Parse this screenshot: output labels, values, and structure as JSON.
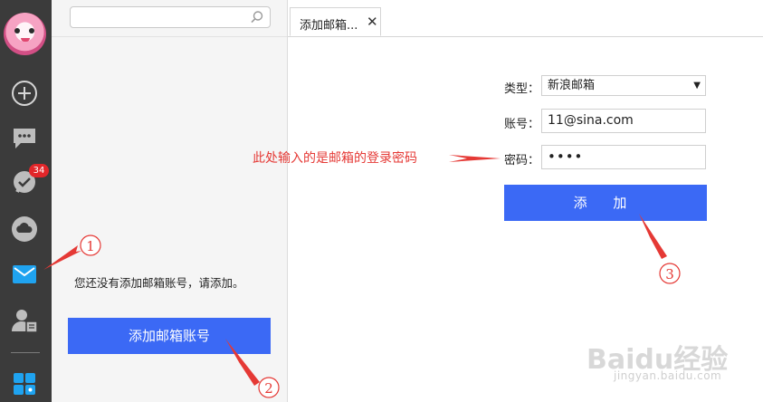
{
  "sidebar": {
    "badge_count": "34",
    "icons": [
      "add-icon",
      "chat-icon",
      "check-message-icon",
      "cloud-icon",
      "mail-icon",
      "contact-card-icon",
      "apps-icon"
    ],
    "active_color": "#1fa3f0"
  },
  "panel": {
    "search_placeholder": "",
    "empty_message": "您还没有添加邮箱账号，请添加。",
    "add_account_button": "添加邮箱账号"
  },
  "tabs": [
    {
      "label": "添加邮箱..."
    }
  ],
  "form": {
    "type_label": "类型：",
    "type_value": "新浪邮箱",
    "account_label": "账号：",
    "account_value": "11@sina.com",
    "password_label": "密码：",
    "password_value": "••••",
    "submit_button": "添 加"
  },
  "annotation": {
    "hint": "此处输入的是邮箱的登录密码",
    "steps": [
      "1",
      "2",
      "3"
    ],
    "color": "#e53935"
  },
  "watermark": {
    "logo": "Baidu经验",
    "url": "jingyan.baidu.com"
  },
  "colors": {
    "sidebar_bg": "#3b3b3b",
    "accent": "#3b69f5",
    "badge": "#e2262a"
  }
}
